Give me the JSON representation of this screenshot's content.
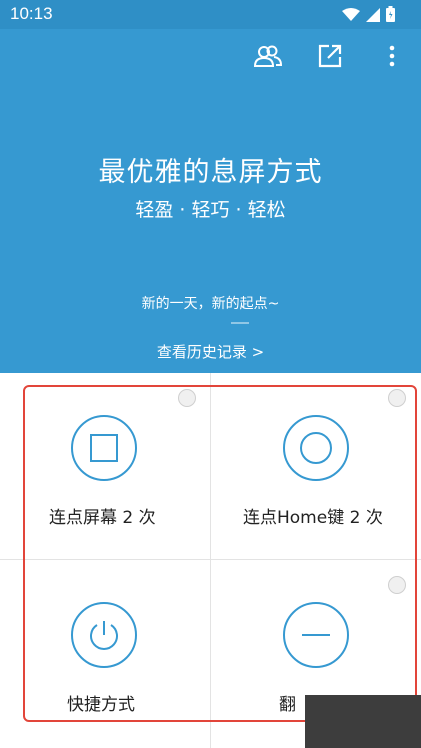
{
  "status_bar": {
    "time": "10:13",
    "icons": [
      "wifi-icon",
      "signal-icon",
      "battery-icon"
    ]
  },
  "header": {
    "actions": [
      "group-icon",
      "open-external-icon",
      "more-vert-icon"
    ]
  },
  "hero": {
    "title": "最优雅的息屏方式",
    "subtitle": "轻盈 · 轻巧 · 轻松",
    "quote": "新的一天，新的起点~",
    "history_link": "查看历史记录 >"
  },
  "options": [
    {
      "label": "连点屏幕 2 次",
      "icon": "square-icon"
    },
    {
      "label": "连点Home键 2 次",
      "icon": "home-circle-icon"
    },
    {
      "label": "快捷方式",
      "icon": "power-icon"
    },
    {
      "label": "翻",
      "icon": "minus-icon"
    }
  ],
  "colors": {
    "primary": "#3699d1",
    "status_bar": "#2f8fc6",
    "highlight": "#e2453a"
  }
}
